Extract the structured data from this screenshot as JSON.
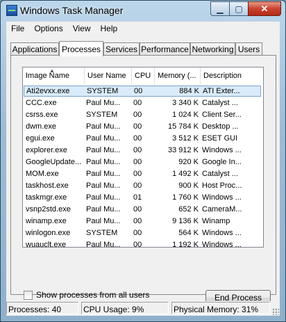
{
  "window": {
    "title": "Windows Task Manager"
  },
  "menu": [
    "File",
    "Options",
    "View",
    "Help"
  ],
  "tabs": [
    "Applications",
    "Processes",
    "Services",
    "Performance",
    "Networking",
    "Users"
  ],
  "active_tab": "Processes",
  "columns": [
    "Image Name",
    "User Name",
    "CPU",
    "Memory (...",
    "Description"
  ],
  "processes": [
    {
      "name": "Ati2evxx.exe",
      "user": "SYSTEM",
      "cpu": "00",
      "mem": "884 K",
      "desc": "ATI Exter..."
    },
    {
      "name": "CCC.exe",
      "user": "Paul Mu...",
      "cpu": "00",
      "mem": "3 340 K",
      "desc": "Catalyst ..."
    },
    {
      "name": "csrss.exe",
      "user": "SYSTEM",
      "cpu": "00",
      "mem": "1 024 K",
      "desc": "Client Ser..."
    },
    {
      "name": "dwm.exe",
      "user": "Paul Mu...",
      "cpu": "00",
      "mem": "15 784 K",
      "desc": "Desktop ..."
    },
    {
      "name": "egui.exe",
      "user": "Paul Mu...",
      "cpu": "00",
      "mem": "3 512 K",
      "desc": "ESET GUI"
    },
    {
      "name": "explorer.exe",
      "user": "Paul Mu...",
      "cpu": "00",
      "mem": "33 912 K",
      "desc": "Windows ..."
    },
    {
      "name": "GoogleUpdate...",
      "user": "Paul Mu...",
      "cpu": "00",
      "mem": "920 K",
      "desc": "Google In..."
    },
    {
      "name": "MOM.exe",
      "user": "Paul Mu...",
      "cpu": "00",
      "mem": "1 492 K",
      "desc": "Catalyst ..."
    },
    {
      "name": "taskhost.exe",
      "user": "Paul Mu...",
      "cpu": "00",
      "mem": "900 K",
      "desc": "Host Proc..."
    },
    {
      "name": "taskmgr.exe",
      "user": "Paul Mu...",
      "cpu": "01",
      "mem": "1 760 K",
      "desc": "Windows ..."
    },
    {
      "name": "vsnp2std.exe",
      "user": "Paul Mu...",
      "cpu": "00",
      "mem": "652 K",
      "desc": "CameraM..."
    },
    {
      "name": "winamp.exe",
      "user": "Paul Mu...",
      "cpu": "00",
      "mem": "9 136 K",
      "desc": "Winamp"
    },
    {
      "name": "winlogon.exe",
      "user": "SYSTEM",
      "cpu": "00",
      "mem": "564 K",
      "desc": "Windows ..."
    },
    {
      "name": "wuauclt.exe",
      "user": "Paul Mu...",
      "cpu": "00",
      "mem": "1 192 K",
      "desc": "Windows ..."
    }
  ],
  "selected_row": 0,
  "show_all_users_label": "Show processes from all users",
  "end_process_label": "End Process",
  "status": {
    "processes": "Processes: 40",
    "cpu": "CPU Usage: 9%",
    "memory": "Physical Memory: 31%"
  },
  "icons": {
    "app": "task-manager-icon",
    "sort": "sort-ascending-icon"
  },
  "colors": {
    "close_button": "#c8432e",
    "selection": "#d9ebf9"
  }
}
